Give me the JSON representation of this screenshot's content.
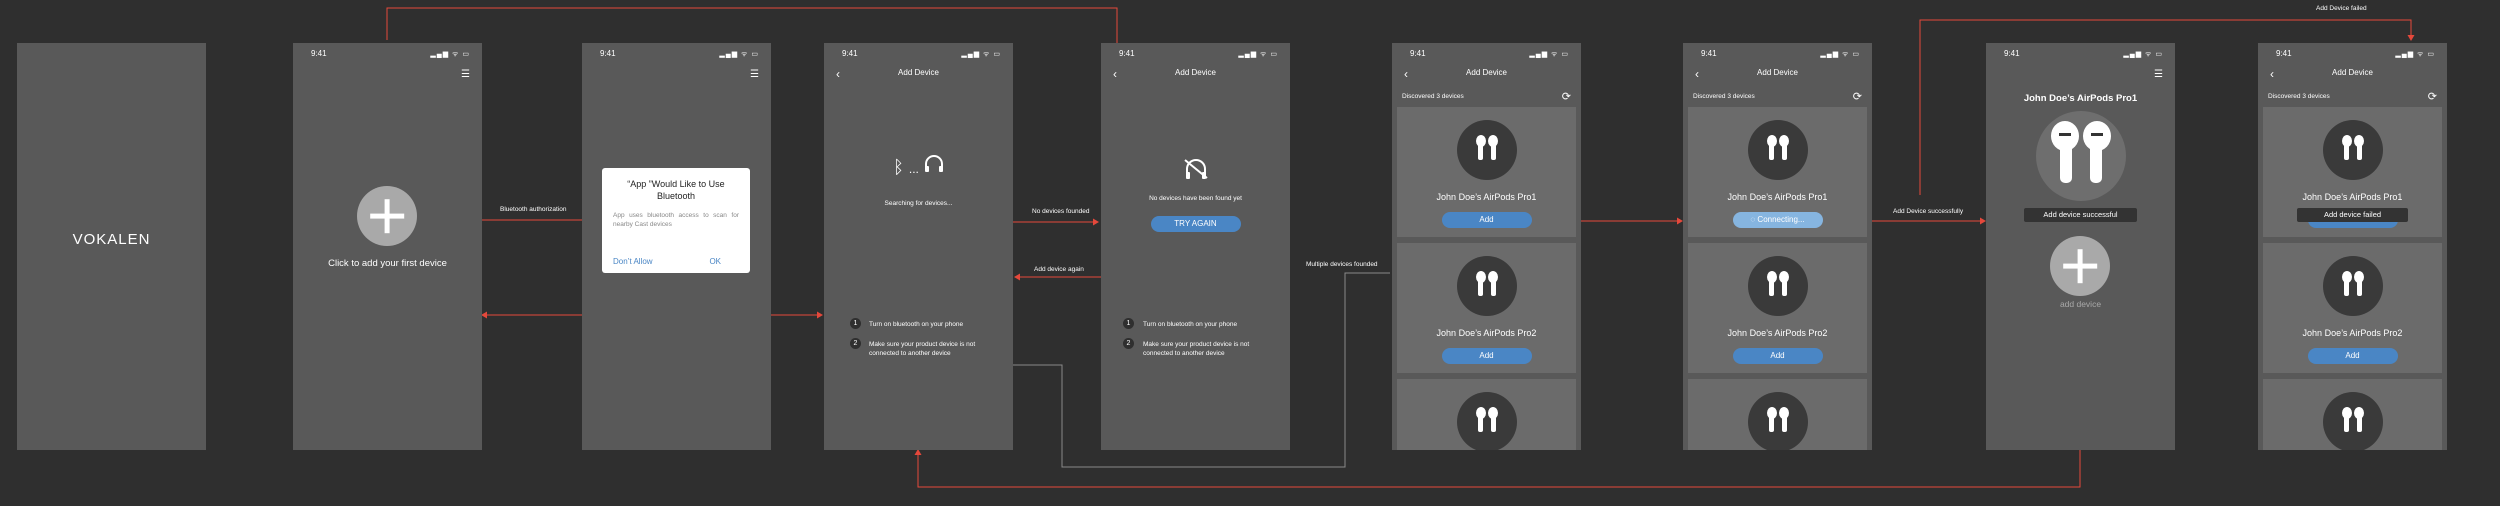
{
  "status": {
    "time": "9:41",
    "signals": "▂▄▆ ᯤ ▭"
  },
  "s1": {
    "brand": "VOKALEN"
  },
  "s2": {
    "caption": "Click to add your first device"
  },
  "s3": {
    "alert_title": "“App ”Would Like to Use Bluetooth",
    "alert_body": "App uses bluetooth access to scan for nearby Cast devices",
    "dont_allow": "Don’t Allow",
    "ok": "OK"
  },
  "add_device_title": "Add Device",
  "s4": {
    "searching": "Searching for devices...",
    "dots": "..."
  },
  "s5": {
    "no_devices": "No devices have been found yet",
    "try_again": "TRY AGAIN"
  },
  "tips": {
    "n1": "1",
    "n2": "2",
    "tip1": "Turn on bluetooth on your phone",
    "tip2": "Make sure your product device is not connected to another device"
  },
  "discovered": "Discovered 3 devices",
  "devices": {
    "d1": "John Doe’s AirPods Pro1",
    "d2": "John Doe’s AirPods Pro2"
  },
  "add_label": "Add",
  "connecting": "Connecting...",
  "s8": {
    "title": "John Doe’s AirPods Pro1",
    "toast": "Add device successful",
    "add_device": "add device"
  },
  "s9": {
    "toast": "Add device failed"
  },
  "arrows": {
    "bt_auth": "Bluetooth authorization",
    "no_found": "No devices founded",
    "add_again": "Add device again",
    "multiple": "Multiple devices founded",
    "success": "Add Device successfully",
    "failed": "Add Device failed"
  },
  "colors": {
    "background": "#2f2f2f",
    "screen": "#595959",
    "card": "#6b6b6b",
    "accent": "#4a86c5",
    "arrow": "#e5483b"
  }
}
